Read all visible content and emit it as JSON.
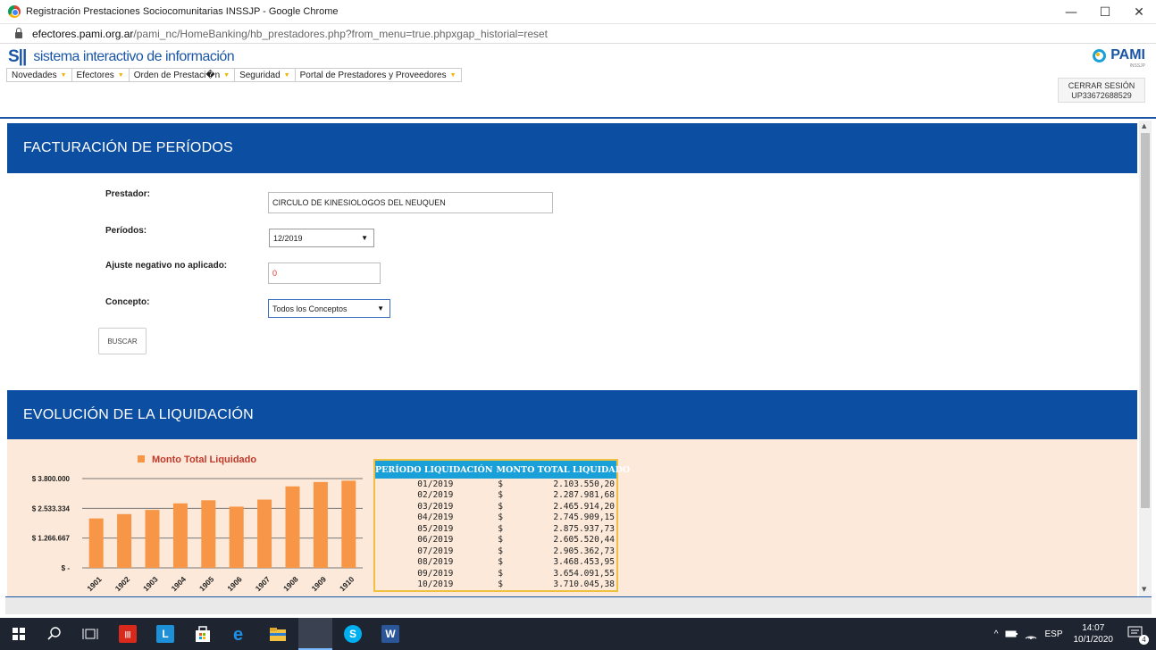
{
  "window": {
    "title": "Registración Prestaciones Sociocomunitarias INSSJP - Google Chrome",
    "minimize": "—",
    "maximize": "☐",
    "close": "✕"
  },
  "address": {
    "domain": "efectores.pami.org.ar",
    "path": "/pami_nc/HomeBanking/hb_prestadores.php?from_menu=true.phpxgap_historial=reset"
  },
  "header": {
    "logo_mark": "S||",
    "logo_text": "sistema interactivo de información",
    "menu": [
      {
        "label": "Novedades"
      },
      {
        "label": "Efectores"
      },
      {
        "label": "Orden de Prestaci�n"
      },
      {
        "label": "Seguridad"
      },
      {
        "label": "Portal de Prestadores y Proveedores"
      }
    ],
    "pami_text": "PAMI",
    "pami_sub": "INSSJP",
    "logout_label": "CERRAR SESIÓN",
    "user_code": "UP33672688529"
  },
  "facturacion": {
    "title": "FACTURACIÓN DE PERÍODOS",
    "prestador_label": "Prestador:",
    "prestador_value": "CIRCULO DE KINESIOLOGOS DEL NEUQUEN",
    "periodos_label": "Períodos:",
    "periodo_value": "12/2019",
    "ajuste_label": "Ajuste negativo no aplicado:",
    "ajuste_value": "0",
    "concepto_label": "Concepto:",
    "concepto_value": "Todos los Conceptos",
    "buscar_label": "BUSCAR"
  },
  "evolucion": {
    "title": "EVOLUCIÓN DE LA LIQUIDACIÓN",
    "table": {
      "headers": [
        "PERÍODO LIQUIDACIÓN",
        "MONTO TOTAL LIQUIDADO"
      ],
      "currency": "$",
      "rows": [
        {
          "periodo": "01/2019",
          "monto": "2.103.550,20"
        },
        {
          "periodo": "02/2019",
          "monto": "2.287.981,68"
        },
        {
          "periodo": "03/2019",
          "monto": "2.465.914,20"
        },
        {
          "periodo": "04/2019",
          "monto": "2.745.909,15"
        },
        {
          "periodo": "05/2019",
          "monto": "2.875.937,73"
        },
        {
          "periodo": "06/2019",
          "monto": "2.605.520,44"
        },
        {
          "periodo": "07/2019",
          "monto": "2.905.362,73"
        },
        {
          "periodo": "08/2019",
          "monto": "3.468.453,95"
        },
        {
          "periodo": "09/2019",
          "monto": "3.654.091,55"
        },
        {
          "periodo": "10/2019",
          "monto": "3.710.045,38"
        }
      ]
    }
  },
  "chart_data": {
    "type": "bar",
    "title": "",
    "legend": "Monto Total Liquidado",
    "legend_position": "top",
    "categories": [
      "1901",
      "1902",
      "1903",
      "1904",
      "1905",
      "1906",
      "1907",
      "1908",
      "1909",
      "1910"
    ],
    "values": [
      2103550.2,
      2287981.68,
      2465914.2,
      2745909.15,
      2875937.73,
      2605520.44,
      2905362.73,
      3468453.95,
      3654091.55,
      3710045.38
    ],
    "ylim": [
      0,
      3800000
    ],
    "yticks": [
      {
        "value": 0,
        "label": "$ -"
      },
      {
        "value": 1266667,
        "label": "$ 1.266.667"
      },
      {
        "value": 2533334,
        "label": "$ 2.533.334"
      },
      {
        "value": 3800000,
        "label": "$ 3.800.000"
      }
    ],
    "grid": true,
    "bar_color": "#f79646",
    "xlabel": "",
    "ylabel": ""
  },
  "taskbar": {
    "lang": "ESP",
    "time": "14:07",
    "date": "10/1/2020",
    "notif_count": "4"
  }
}
